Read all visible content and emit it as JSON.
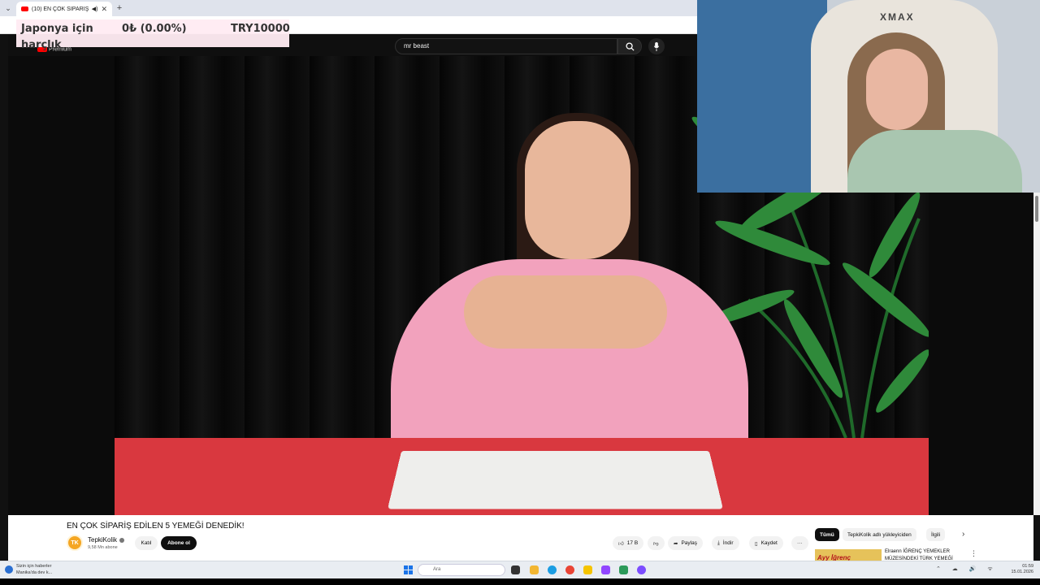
{
  "browser": {
    "tab_title": "(10) EN ÇOK SİPARİŞ EDİLE",
    "new_tab": "+"
  },
  "donation_widget": {
    "label": "Japonya için harçlık",
    "amount": "0₺ (0.00%)",
    "goal": "TRY10000"
  },
  "youtube": {
    "logo_text": "Premium",
    "search_value": "mr beast"
  },
  "webcam": {
    "chair_brand": "XMAX"
  },
  "video_info": {
    "title": "EN ÇOK SİPARİŞ EDİLEN 5 YEMEĞİ DENEDİK!",
    "channel_avatar": "TK",
    "channel_name": "TepkiKolik",
    "subscribers": "9,58 Mn abone",
    "join_label": "Katıl",
    "subscribe_label": "Abone ol",
    "likes": "17 B",
    "share_label": "Paylaş",
    "download_label": "İndir",
    "save_label": "Kaydet",
    "more_label": "···"
  },
  "recommendations": {
    "chips": [
      "Tümü",
      "TepkiKolik adlı yükleyiciden",
      "İlgili"
    ],
    "thumb_text": "Ayy İğrenç",
    "first_title": "Elraenn İĞRENÇ YEMEKLER MÜZESİNDEKİ TÜRK YEMEĞİ",
    "more": "⋮"
  },
  "taskbar": {
    "news_line1": "Sizin için haberler",
    "news_line2": "Manika'da dev k...",
    "search_placeholder": "Ara",
    "time": "01:59",
    "date": "15.01.2026",
    "tray": "⌃ ☁ 🔊 ᯤ"
  },
  "colors": {
    "youtube_red": "#ff0000",
    "table_red": "#d9383f",
    "shirt_pink": "#f2a2bd",
    "widget_bg": "#ffebf3"
  }
}
